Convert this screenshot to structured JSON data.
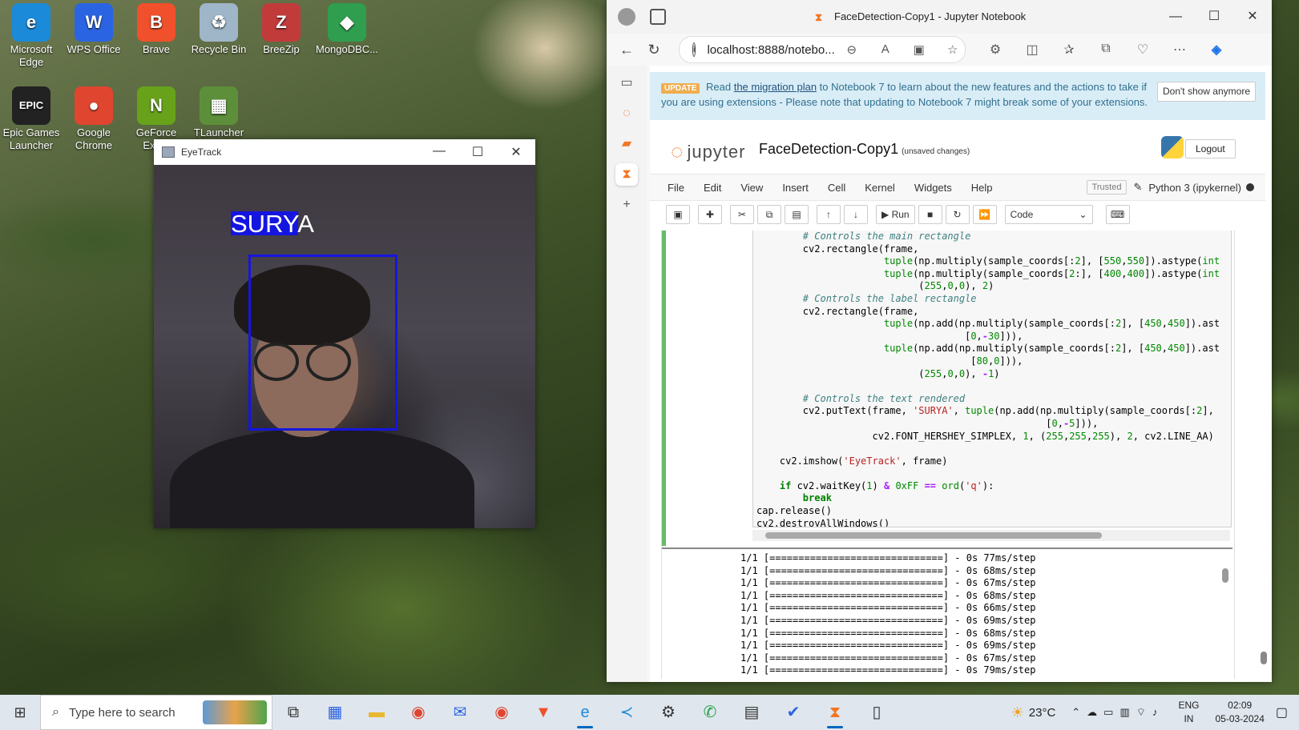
{
  "desktop": {
    "icons": [
      {
        "label": "Microsoft Edge",
        "glyph": "e",
        "color": "#1b8ad8"
      },
      {
        "label": "WPS Office",
        "glyph": "W",
        "color": "#2b64e3"
      },
      {
        "label": "Brave",
        "glyph": "B",
        "color": "#f0502b"
      },
      {
        "label": "Recycle Bin",
        "glyph": "♻",
        "color": "#9fb5c8"
      },
      {
        "label": "BreeZip",
        "glyph": "Z",
        "color": "#c23b3b"
      },
      {
        "label": "MongoDBC...",
        "glyph": "◆",
        "color": "#2f9e4f"
      },
      {
        "label": "Epic Games Launcher",
        "glyph": "EPIC",
        "color": "#222222"
      },
      {
        "label": "Google Chrome",
        "glyph": "●",
        "color": "#e0452f"
      },
      {
        "label": "GeForce Exp...",
        "glyph": "N",
        "color": "#67a21a"
      },
      {
        "label": "TLauncher",
        "glyph": "▦",
        "color": "#5d8f3a"
      }
    ]
  },
  "eyetrack": {
    "title": "EyeTrack",
    "label_text": "SURYA",
    "min": "—",
    "max": "☐",
    "close": "✕"
  },
  "browser": {
    "tab_title": "FaceDetection-Copy1 - Jupyter Notebook",
    "url": "localhost:8888/notebo...",
    "win_min": "—",
    "win_max": "☐",
    "win_close": "✕"
  },
  "jupyter": {
    "banner": {
      "badge": "UPDATE",
      "read": "Read",
      "link": "the migration plan",
      "text": " to Notebook 7 to learn about the new features and the actions to take if you are using extensions - Please note that updating to Notebook 7 might break some of your extensions.",
      "dismiss": "Don't show anymore"
    },
    "logo": "jupyter",
    "notebook_name": "FaceDetection-Copy1",
    "save_status": "(unsaved changes)",
    "logout": "Logout",
    "menu": [
      "File",
      "Edit",
      "View",
      "Insert",
      "Cell",
      "Kernel",
      "Widgets",
      "Help"
    ],
    "trusted": "Trusted",
    "kernel": "Python 3 (ipykernel)",
    "run_label": "Run",
    "cell_type": "Code",
    "output_lines": [
      "1/1 [==============================] - 0s 77ms/step",
      "1/1 [==============================] - 0s 68ms/step",
      "1/1 [==============================] - 0s 67ms/step",
      "1/1 [==============================] - 0s 68ms/step",
      "1/1 [==============================] - 0s 66ms/step",
      "1/1 [==============================] - 0s 69ms/step",
      "1/1 [==============================] - 0s 68ms/step",
      "1/1 [==============================] - 0s 69ms/step",
      "1/1 [==============================] - 0s 67ms/step",
      "1/1 [==============================] - 0s 79ms/step"
    ]
  },
  "taskbar": {
    "search_placeholder": "Type here to search",
    "temperature": "23°C",
    "lang_top": "ENG",
    "lang_bottom": "IN",
    "time": "02:09",
    "date": "05-03-2024"
  }
}
